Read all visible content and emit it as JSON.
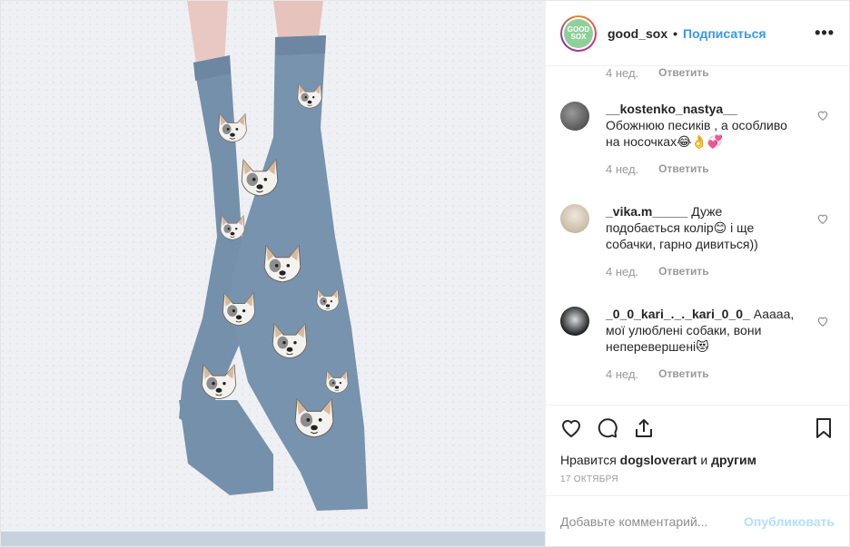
{
  "header": {
    "logo_text": "GOOD SOX",
    "username": "good_sox",
    "separator": "•",
    "follow_label": "Подписаться",
    "more_label": "•••"
  },
  "top_meta": {
    "age": "4 нед.",
    "reply_label": "Ответить"
  },
  "comments": [
    {
      "user": "__kostenko_nastya__",
      "text": " Обожнюю песиків , а особливо на носочках😂👌💞",
      "age": "4 нед.",
      "reply_label": "Ответить",
      "avatar_color": "#5a5a5a"
    },
    {
      "user": "_vika.m_____",
      "text": " Дуже подобається колір😊 і ще собачки, гарно дивиться))",
      "age": "4 нед.",
      "reply_label": "Ответить",
      "avatar_color": "#d8cfc2"
    },
    {
      "user": "_0_0_kari_._._kari_0_0_",
      "text": " Ааааа, мої улюблені собаки, вони неперевершені😻",
      "age": "4 нед.",
      "reply_label": "Ответить",
      "avatar_color": "#2a2a2a"
    }
  ],
  "actions": {
    "like_icon": "heart-icon",
    "comment_icon": "comment-icon",
    "share_icon": "share-icon",
    "save_icon": "bookmark-icon"
  },
  "likes": {
    "prefix": "Нравится ",
    "user": "dogsloverart",
    "middle": " и ",
    "others": "другим"
  },
  "date": "17 ОКТЯБРЯ",
  "add_comment": {
    "placeholder": "Добавьте комментарий...",
    "publish_label": "Опубликовать"
  },
  "colors": {
    "accent": "#3897f0",
    "publish_disabled": "#b2dffc",
    "muted": "#999999",
    "sock": "#7893ad"
  }
}
